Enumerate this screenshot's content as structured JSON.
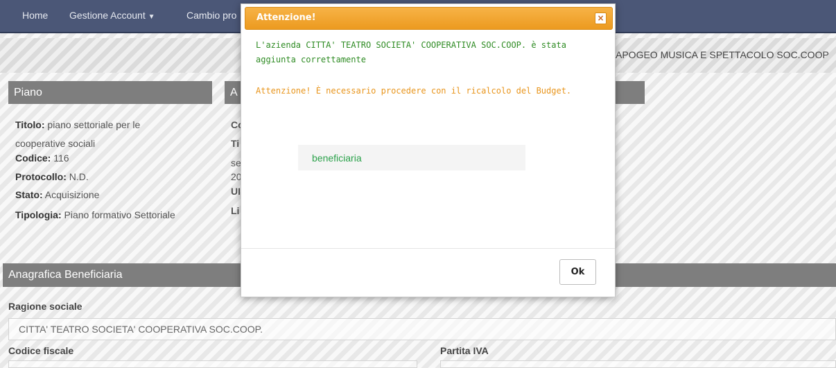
{
  "navbar": {
    "home": "Home",
    "gestione_account": "Gestione Account",
    "cambio": "Cambio pro"
  },
  "band": {
    "text": "APOGEO MUSICA E SPETTACOLO SOC.COOP"
  },
  "piano": {
    "header": "Piano",
    "titolo_label": "Titolo:",
    "titolo_value_1": "piano settoriale per le",
    "titolo_value_2": "cooperative sociali",
    "codice_label": "Codice:",
    "codice_value": "116",
    "protocollo_label": "Protocollo:",
    "protocollo_value": "N.D.",
    "stato_label": "Stato:",
    "stato_value": "Acquisizione",
    "tipologia_label": "Tipologia:",
    "tipologia_value": "Piano formativo Settoriale"
  },
  "second_panel": {
    "header_fragment": "A",
    "lines": [
      "Co",
      "Ti",
      "se",
      "20",
      "UI",
      "Li"
    ]
  },
  "anagrafica": {
    "header": "Anagrafica Beneficiaria",
    "ragione_sociale_label": "Ragione sociale",
    "ragione_sociale_value": "CITTA' TEATRO SOCIETA' COOPERATIVA SOC.COOP.",
    "codice_fiscale_label": "Codice fiscale",
    "partita_iva_label": "Partita IVA"
  },
  "modal": {
    "title": "Attenzione!",
    "close_glyph": "×",
    "success_message": "L'azienda CITTA' TEATRO SOCIETA' COOPERATIVA SOC.COOP. è stata aggiunta correttamente",
    "warning_message": "Attenzione! È necessario procedere con il ricalcolo del Budget.",
    "beneficiaria_text": "beneficiaria",
    "ok_label": "Ok"
  },
  "colors": {
    "navbar": "#4b5777",
    "modal_header": "#ec9a1f",
    "success": "#2e8b23",
    "warning": "#e8951c",
    "panel_header": "#7e7e7e"
  }
}
